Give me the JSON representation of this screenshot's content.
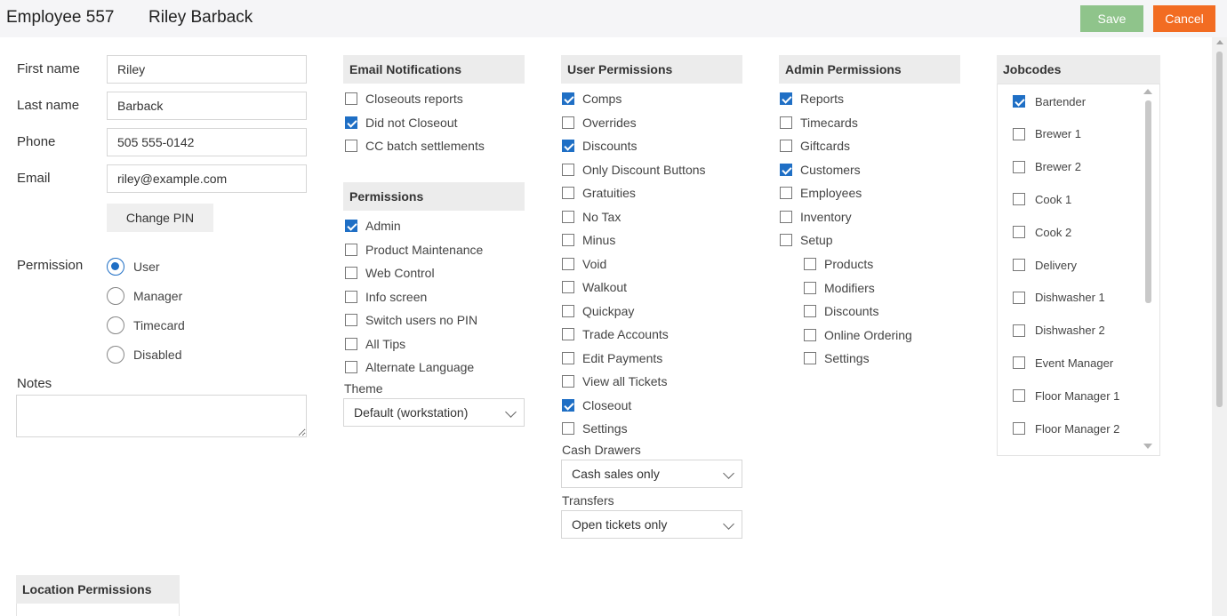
{
  "header": {
    "title": "Employee 557",
    "name": "Riley Barback",
    "save_label": "Save",
    "cancel_label": "Cancel",
    "save_color": "#8fc48b",
    "cancel_color": "#f26c22"
  },
  "form": {
    "first_name_label": "First name",
    "first_name_value": "Riley",
    "last_name_label": "Last name",
    "last_name_value": "Barback",
    "phone_label": "Phone",
    "phone_value": "505 555-0142",
    "email_label": "Email",
    "email_value": "riley@example.com",
    "change_pin_label": "Change PIN",
    "permission_label": "Permission",
    "permission_options": [
      {
        "label": "User",
        "selected": true
      },
      {
        "label": "Manager",
        "selected": false
      },
      {
        "label": "Timecard",
        "selected": false
      },
      {
        "label": "Disabled",
        "selected": false
      }
    ],
    "notes_label": "Notes",
    "notes_value": ""
  },
  "email_notifications": {
    "title": "Email Notifications",
    "items": [
      {
        "label": "Closeouts reports",
        "checked": false
      },
      {
        "label": "Did not Closeout",
        "checked": true
      },
      {
        "label": "CC batch settlements",
        "checked": false
      }
    ]
  },
  "permissions": {
    "title": "Permissions",
    "items": [
      {
        "label": "Admin",
        "checked": true
      },
      {
        "label": "Product Maintenance",
        "checked": false
      },
      {
        "label": "Web Control",
        "checked": false
      },
      {
        "label": "Info screen",
        "checked": false
      },
      {
        "label": "Switch users no PIN",
        "checked": false
      },
      {
        "label": "All Tips",
        "checked": false
      },
      {
        "label": "Alternate Language",
        "checked": false
      }
    ],
    "theme_label": "Theme",
    "theme_value": "Default (workstation)"
  },
  "user_permissions": {
    "title": "User Permissions",
    "items": [
      {
        "label": "Comps",
        "checked": true
      },
      {
        "label": "Overrides",
        "checked": false
      },
      {
        "label": "Discounts",
        "checked": true
      },
      {
        "label": "Only Discount Buttons",
        "checked": false
      },
      {
        "label": "Gratuities",
        "checked": false
      },
      {
        "label": "No Tax",
        "checked": false
      },
      {
        "label": "Minus",
        "checked": false
      },
      {
        "label": "Void",
        "checked": false
      },
      {
        "label": "Walkout",
        "checked": false
      },
      {
        "label": "Quickpay",
        "checked": false
      },
      {
        "label": "Trade Accounts",
        "checked": false
      },
      {
        "label": "Edit Payments",
        "checked": false
      },
      {
        "label": "View all Tickets",
        "checked": false
      },
      {
        "label": "Closeout",
        "checked": true
      },
      {
        "label": "Settings",
        "checked": false
      }
    ],
    "cash_drawers_label": "Cash Drawers",
    "cash_drawers_value": "Cash sales only",
    "transfers_label": "Transfers",
    "transfers_value": "Open tickets only"
  },
  "admin_permissions": {
    "title": "Admin Permissions",
    "items": [
      {
        "label": "Reports",
        "checked": true
      },
      {
        "label": "Timecards",
        "checked": false
      },
      {
        "label": "Giftcards",
        "checked": false
      },
      {
        "label": "Customers",
        "checked": true
      },
      {
        "label": "Employees",
        "checked": false
      },
      {
        "label": "Inventory",
        "checked": false
      },
      {
        "label": "Setup",
        "checked": false
      }
    ],
    "setup_items": [
      {
        "label": "Products",
        "checked": false
      },
      {
        "label": "Modifiers",
        "checked": false
      },
      {
        "label": "Discounts",
        "checked": false
      },
      {
        "label": "Online Ordering",
        "checked": false
      },
      {
        "label": "Settings",
        "checked": false
      }
    ]
  },
  "jobcodes": {
    "title": "Jobcodes",
    "items": [
      {
        "label": "Bartender",
        "checked": true
      },
      {
        "label": "Brewer 1",
        "checked": false
      },
      {
        "label": "Brewer 2",
        "checked": false
      },
      {
        "label": "Cook 1",
        "checked": false
      },
      {
        "label": "Cook 2",
        "checked": false
      },
      {
        "label": "Delivery",
        "checked": false
      },
      {
        "label": "Dishwasher 1",
        "checked": false
      },
      {
        "label": "Dishwasher 2",
        "checked": false
      },
      {
        "label": "Event Manager",
        "checked": false
      },
      {
        "label": "Floor Manager 1",
        "checked": false
      },
      {
        "label": "Floor Manager 2",
        "checked": false
      }
    ]
  },
  "location_permissions": {
    "title": "Location Permissions"
  },
  "colors": {
    "accent": "#1f6fc5",
    "panel_header_bg": "#ececec"
  }
}
